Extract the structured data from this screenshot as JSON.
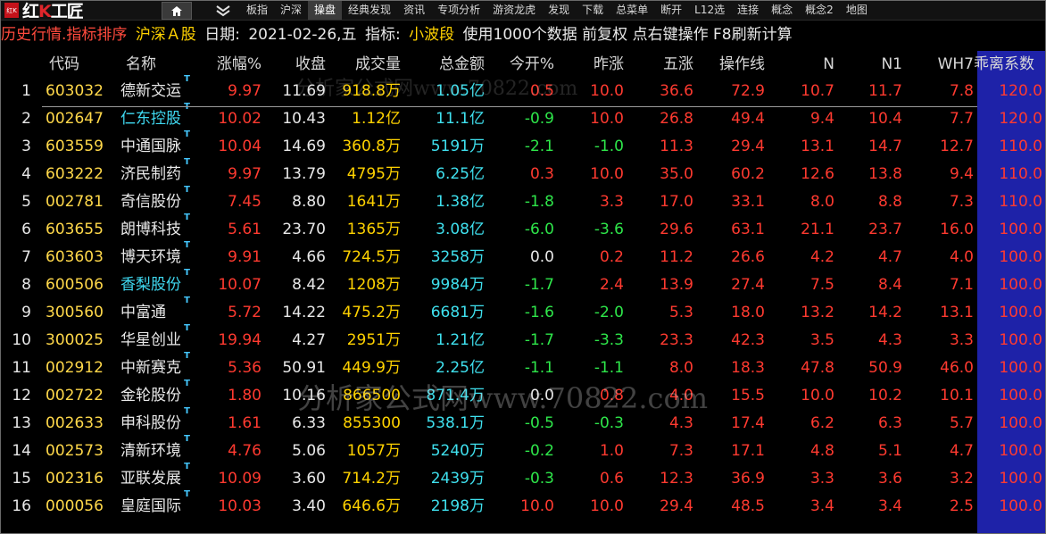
{
  "logo": {
    "seal": "红K",
    "text_a": "红",
    "text_k": "K",
    "text_b": "工匠"
  },
  "menu": [
    "板指",
    "沪深",
    "操盘",
    "经典发现",
    "资讯",
    "专项分析",
    "游资龙虎",
    "发现",
    "下载",
    "总菜单",
    "断开",
    "L12选",
    "连接",
    "概念",
    "概念2",
    "地图"
  ],
  "menu_active": "操盘",
  "titlebar": {
    "section": "历史行情.指标排序",
    "market": "沪深Ａ股",
    "date_label": "日期:",
    "date": "2021-02-26,五",
    "indicator_label": "指标:",
    "indicator": "小波段",
    "info": "使用1000个数据 前复权 点右键操作 F8刷新计算"
  },
  "columns": [
    "",
    "代码",
    "名称",
    "涨幅%",
    "收盘",
    "成交量",
    "总金额",
    "今开%",
    "昨涨",
    "五涨",
    "操作线",
    "N",
    "N1",
    "WH7",
    "乖离系数"
  ],
  "rows": [
    {
      "idx": "1",
      "code": "603032",
      "name": "德新交运",
      "nc": "name-white",
      "chg": "9.97",
      "close": "11.69",
      "vol": "918.8万",
      "amt": "1.05亿",
      "open": "0.5",
      "oc": "red",
      "yest": "10.0",
      "yc": "red",
      "five": "36.6",
      "op": "72.9",
      "n": "10.7",
      "n1": "11.7",
      "wh7": "7.8",
      "coef": "120.0"
    },
    {
      "idx": "2",
      "code": "002647",
      "name": "仁东控股",
      "nc": "name-cyan",
      "chg": "10.02",
      "close": "10.43",
      "vol": "1.12亿",
      "amt": "11.1亿",
      "open": "-0.9",
      "oc": "green",
      "yest": "10.0",
      "yc": "red",
      "five": "26.8",
      "op": "49.4",
      "n": "9.4",
      "n1": "10.4",
      "wh7": "7.7",
      "coef": "120.0"
    },
    {
      "idx": "3",
      "code": "603559",
      "name": "中通国脉",
      "nc": "name-white",
      "chg": "10.04",
      "close": "14.69",
      "vol": "360.8万",
      "amt": "5191万",
      "open": "-2.1",
      "oc": "green",
      "yest": "-1.0",
      "yc": "green",
      "five": "11.3",
      "op": "29.4",
      "n": "13.1",
      "n1": "14.7",
      "wh7": "12.7",
      "coef": "110.0"
    },
    {
      "idx": "4",
      "code": "603222",
      "name": "济民制药",
      "nc": "name-white",
      "chg": "9.97",
      "close": "13.79",
      "vol": "4795万",
      "amt": "6.25亿",
      "open": "0.3",
      "oc": "red",
      "yest": "10.0",
      "yc": "red",
      "five": "35.0",
      "op": "60.2",
      "n": "12.6",
      "n1": "13.8",
      "wh7": "9.4",
      "coef": "110.0"
    },
    {
      "idx": "5",
      "code": "002781",
      "name": "奇信股份",
      "nc": "name-white",
      "chg": "7.45",
      "close": "8.80",
      "vol": "1641万",
      "amt": "1.38亿",
      "open": "-1.8",
      "oc": "green",
      "yest": "3.3",
      "yc": "red",
      "five": "17.0",
      "op": "33.1",
      "n": "8.0",
      "n1": "8.8",
      "wh7": "7.3",
      "coef": "110.0"
    },
    {
      "idx": "6",
      "code": "603655",
      "name": "朗博科技",
      "nc": "name-white",
      "chg": "5.61",
      "close": "23.70",
      "vol": "1365万",
      "amt": "3.08亿",
      "open": "-6.0",
      "oc": "green",
      "yest": "-3.6",
      "yc": "green",
      "five": "29.6",
      "op": "63.1",
      "n": "21.1",
      "n1": "23.7",
      "wh7": "16.0",
      "coef": "100.0"
    },
    {
      "idx": "7",
      "code": "603603",
      "name": "博天环境",
      "nc": "name-white",
      "chg": "9.91",
      "close": "4.66",
      "vol": "724.5万",
      "amt": "3258万",
      "open": "0.0",
      "oc": "white",
      "yest": "0.2",
      "yc": "red",
      "five": "11.2",
      "op": "26.6",
      "n": "4.2",
      "n1": "4.7",
      "wh7": "4.0",
      "coef": "100.0"
    },
    {
      "idx": "8",
      "code": "600506",
      "name": "香梨股份",
      "nc": "name-cyan",
      "chg": "10.07",
      "close": "8.42",
      "vol": "1208万",
      "amt": "9984万",
      "open": "-1.7",
      "oc": "green",
      "yest": "2.4",
      "yc": "red",
      "five": "13.9",
      "op": "27.4",
      "n": "7.5",
      "n1": "8.4",
      "wh7": "7.1",
      "coef": "100.0"
    },
    {
      "idx": "9",
      "code": "300560",
      "name": "中富通",
      "nc": "name-white",
      "chg": "5.72",
      "close": "14.22",
      "vol": "475.2万",
      "amt": "6681万",
      "open": "-1.6",
      "oc": "green",
      "yest": "-2.0",
      "yc": "green",
      "five": "5.3",
      "op": "18.0",
      "n": "13.2",
      "n1": "14.2",
      "wh7": "13.1",
      "coef": "100.0"
    },
    {
      "idx": "10",
      "code": "300025",
      "name": "华星创业",
      "nc": "name-white",
      "chg": "19.94",
      "close": "4.27",
      "vol": "2951万",
      "amt": "1.21亿",
      "open": "-1.7",
      "oc": "green",
      "yest": "-3.3",
      "yc": "green",
      "five": "23.3",
      "op": "42.3",
      "n": "3.5",
      "n1": "4.3",
      "wh7": "3.3",
      "coef": "100.0"
    },
    {
      "idx": "11",
      "code": "002912",
      "name": "中新赛克",
      "nc": "name-white",
      "chg": "5.36",
      "close": "50.91",
      "vol": "449.9万",
      "amt": "2.25亿",
      "open": "-1.1",
      "oc": "green",
      "yest": "-1.1",
      "yc": "green",
      "five": "8.0",
      "op": "18.3",
      "n": "47.8",
      "n1": "50.9",
      "wh7": "46.0",
      "coef": "100.0"
    },
    {
      "idx": "12",
      "code": "002722",
      "name": "金轮股份",
      "nc": "name-white",
      "chg": "1.80",
      "close": "10.16",
      "vol": "866500",
      "amt": "871.4万",
      "open": "0.0",
      "oc": "white",
      "yest": "0.8",
      "yc": "red",
      "five": "4.0",
      "op": "15.5",
      "n": "10.0",
      "n1": "10.2",
      "wh7": "10.1",
      "coef": "100.0"
    },
    {
      "idx": "13",
      "code": "002633",
      "name": "申科股份",
      "nc": "name-white",
      "chg": "1.61",
      "close": "6.33",
      "vol": "855300",
      "amt": "538.1万",
      "open": "-0.5",
      "oc": "green",
      "yest": "-0.3",
      "yc": "green",
      "five": "4.3",
      "op": "17.4",
      "n": "6.2",
      "n1": "6.3",
      "wh7": "5.7",
      "coef": "100.0"
    },
    {
      "idx": "14",
      "code": "002573",
      "name": "清新环境",
      "nc": "name-white",
      "chg": "4.76",
      "close": "5.06",
      "vol": "1057万",
      "amt": "5240万",
      "open": "-0.2",
      "oc": "green",
      "yest": "1.0",
      "yc": "red",
      "five": "7.3",
      "op": "17.1",
      "n": "4.8",
      "n1": "5.1",
      "wh7": "4.7",
      "coef": "100.0"
    },
    {
      "idx": "15",
      "code": "002316",
      "name": "亚联发展",
      "nc": "name-white",
      "chg": "10.09",
      "close": "3.60",
      "vol": "714.2万",
      "amt": "2439万",
      "open": "-0.3",
      "oc": "green",
      "yest": "0.6",
      "yc": "red",
      "five": "12.3",
      "op": "36.9",
      "n": "3.3",
      "n1": "3.6",
      "wh7": "3.2",
      "coef": "100.0"
    },
    {
      "idx": "16",
      "code": "000056",
      "name": "皇庭国际",
      "nc": "name-white",
      "chg": "10.03",
      "close": "3.40",
      "vol": "646.6万",
      "amt": "2198万",
      "open": "10.0",
      "oc": "red",
      "yest": "10.0",
      "yc": "red",
      "five": "29.4",
      "op": "48.5",
      "n": "3.4",
      "n1": "3.4",
      "wh7": "2.5",
      "coef": "100.0"
    }
  ],
  "watermark": {
    "small": "分析家公式网www.70822.com",
    "large": "分析家公式网www.70822.com"
  },
  "ext_mark": "T",
  "colors": {
    "up": "#ff3a30",
    "down": "#2ee64a",
    "band": "#1e22a8"
  }
}
